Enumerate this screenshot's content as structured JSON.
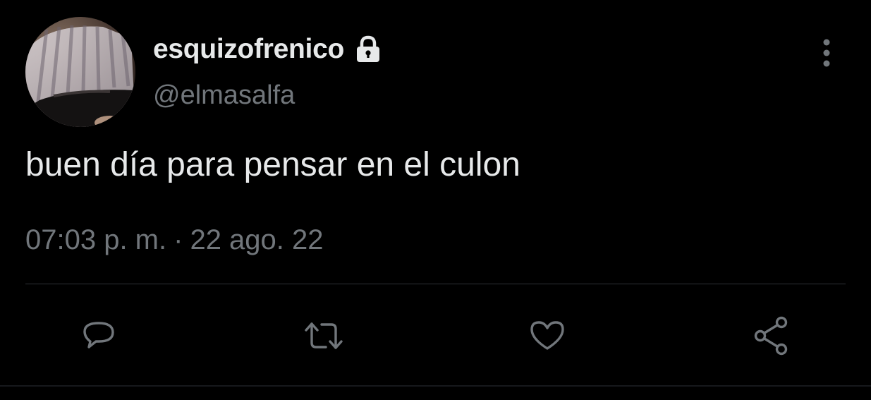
{
  "user": {
    "display_name": "esquizofrenico",
    "handle": "@elmasalfa",
    "protected_icon": "lock-icon",
    "avatar": "profile-photo"
  },
  "tweet": {
    "text": "buen día para pensar en el culon",
    "time": "07:03 p. m.",
    "separator": "·",
    "date": "22 ago. 22"
  },
  "actions": [
    {
      "name": "reply",
      "icon": "speech-bubble-icon"
    },
    {
      "name": "retweet",
      "icon": "retweet-arrows-icon"
    },
    {
      "name": "like",
      "icon": "heart-icon"
    },
    {
      "name": "share",
      "icon": "share-nodes-icon"
    }
  ],
  "menu_icon": "vertical-dots-icon",
  "colors": {
    "background": "#000000",
    "primary_text": "#e7e9ea",
    "secondary_text": "#71767b",
    "divider": "#2f3336"
  }
}
